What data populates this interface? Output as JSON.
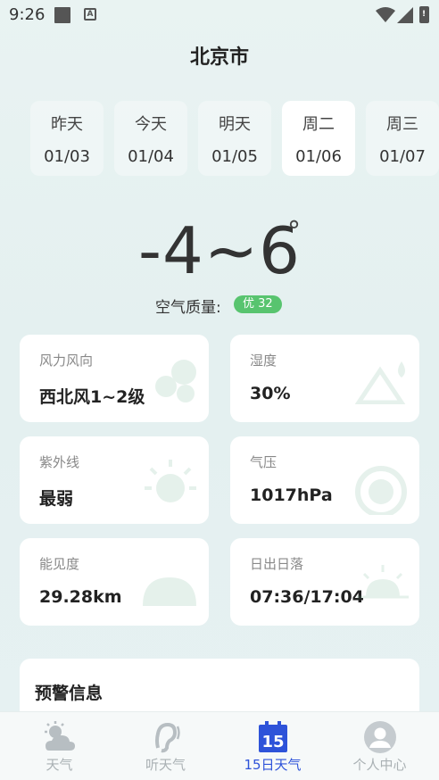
{
  "status_bar": {
    "time": "9:26",
    "a_icon": "A"
  },
  "header": {
    "city": "北京市"
  },
  "days": [
    {
      "name": "昨天",
      "date": "01/03"
    },
    {
      "name": "今天",
      "date": "01/04"
    },
    {
      "name": "明天",
      "date": "01/05"
    },
    {
      "name": "周二",
      "date": "01/06",
      "selected": true
    },
    {
      "name": "周三",
      "date": "01/07"
    }
  ],
  "weather": {
    "temp_range": "-4~6",
    "degree": "°",
    "aqi_label": "空气质量:",
    "aqi_badge": "优 32"
  },
  "cards": [
    {
      "label": "风力风向",
      "value": "西北风1~2级",
      "icon": "wind-icon"
    },
    {
      "label": "湿度",
      "value": "30%",
      "icon": "humidity-icon"
    },
    {
      "label": "紫外线",
      "value": "最弱",
      "icon": "sun-icon"
    },
    {
      "label": "气压",
      "value": "1017hPa",
      "icon": "gauge-icon"
    },
    {
      "label": "能见度",
      "value": "29.28km",
      "icon": "cloud-icon"
    },
    {
      "label": "日出日落",
      "value": "07:36/17:04",
      "icon": "sunrise-icon"
    }
  ],
  "warning": {
    "title": "预警信息"
  },
  "tabs": [
    {
      "label": "天气",
      "icon": "weather-icon"
    },
    {
      "label": "听天气",
      "icon": "ear-icon"
    },
    {
      "label": "15日天气",
      "icon": "calendar-15-icon",
      "active": true,
      "icon_text": "15"
    },
    {
      "label": "个人中心",
      "icon": "user-icon"
    }
  ],
  "colors": {
    "accent": "#2e53d9",
    "aqi_good": "#58c46f",
    "background": "#e6f1f1"
  }
}
